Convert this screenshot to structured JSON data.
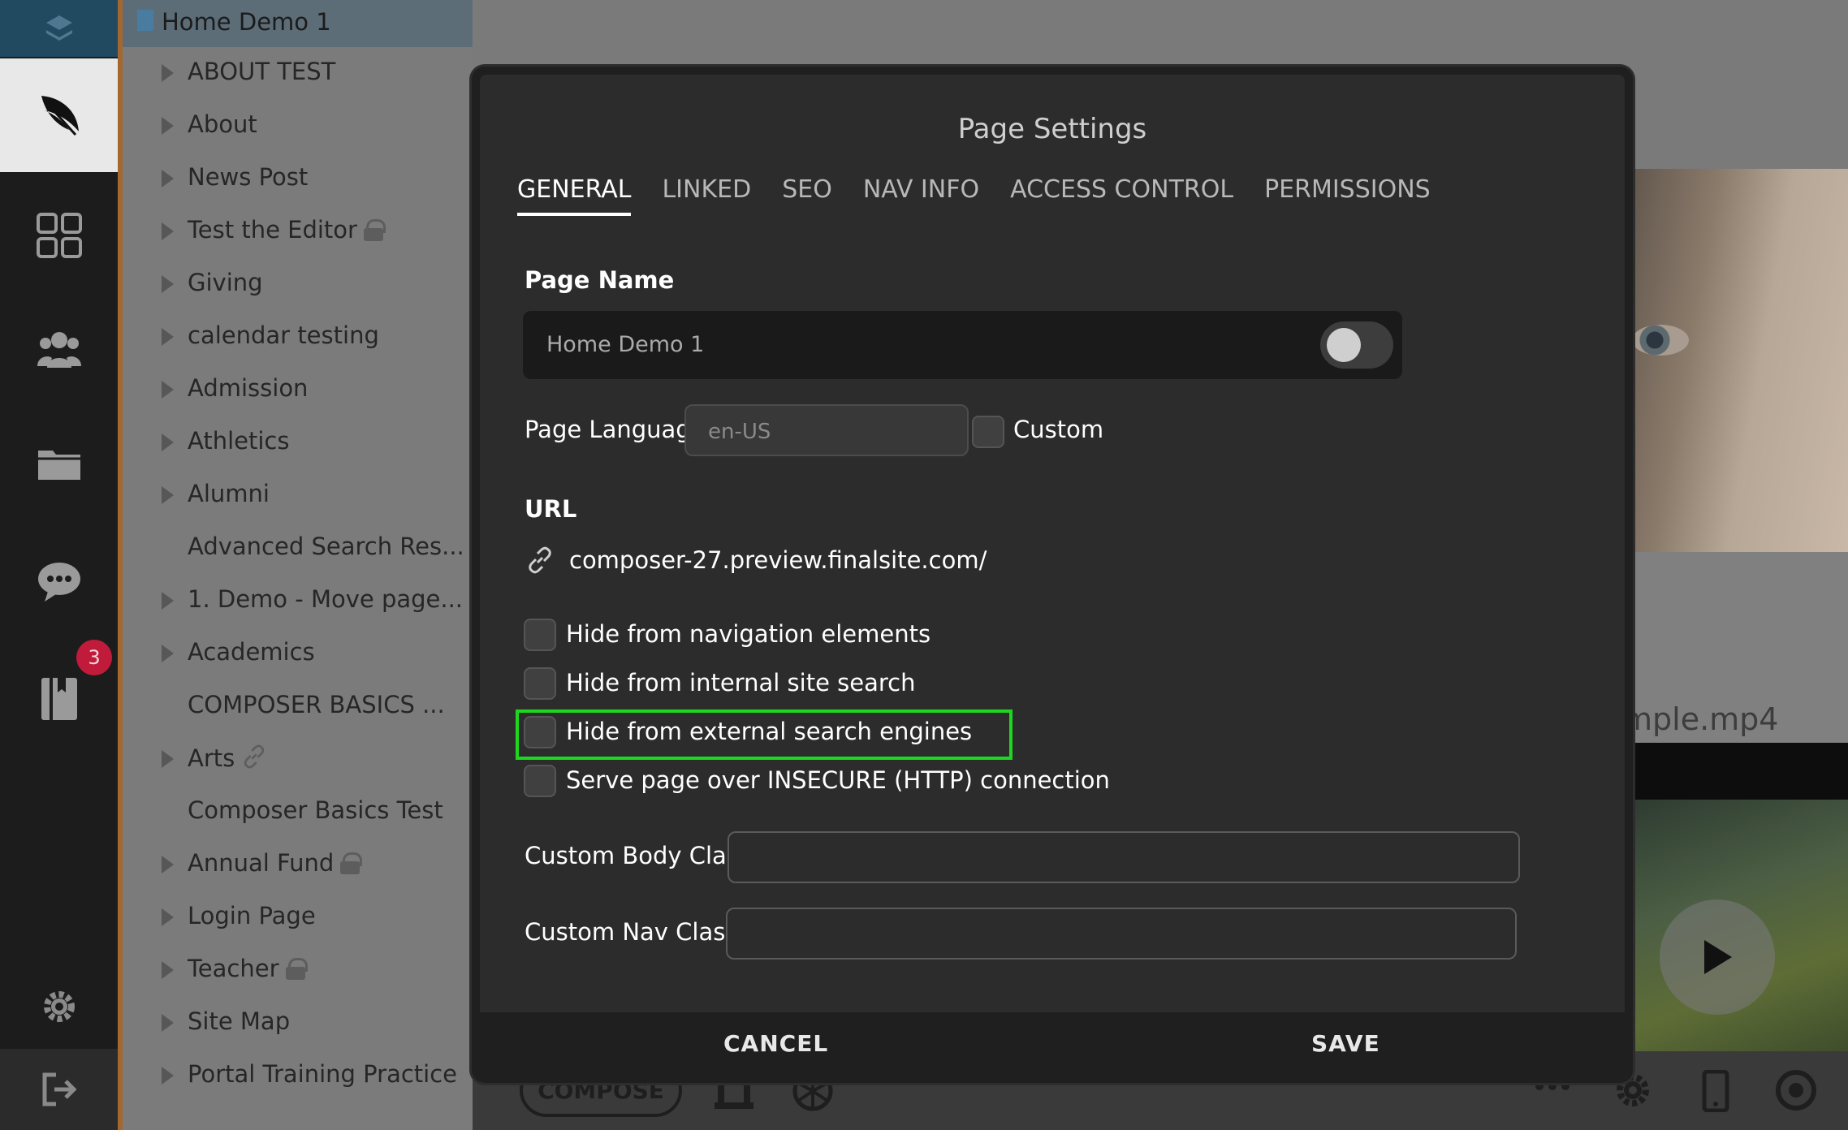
{
  "rail": {
    "badge_count": "3",
    "icons": [
      "layers-icon",
      "quill-icon",
      "apps-icon",
      "users-icon",
      "folder-icon",
      "chat-icon",
      "book-icon",
      "gear-icon",
      "logout-icon"
    ]
  },
  "tree": {
    "root_title": "Home Demo 1",
    "items": [
      {
        "label": "ABOUT TEST",
        "arrow": true,
        "lock": false,
        "link": false
      },
      {
        "label": "About",
        "arrow": true,
        "lock": false,
        "link": false
      },
      {
        "label": "News Post",
        "arrow": true,
        "lock": false,
        "link": false
      },
      {
        "label": "Test the Editor",
        "arrow": true,
        "lock": true,
        "link": false
      },
      {
        "label": "Giving",
        "arrow": true,
        "lock": false,
        "link": false
      },
      {
        "label": "calendar testing",
        "arrow": true,
        "lock": false,
        "link": false
      },
      {
        "label": "Admission",
        "arrow": true,
        "lock": false,
        "link": false
      },
      {
        "label": "Athletics",
        "arrow": true,
        "lock": false,
        "link": false
      },
      {
        "label": "Alumni",
        "arrow": true,
        "lock": false,
        "link": false
      },
      {
        "label": "Advanced Search Res...",
        "arrow": false,
        "lock": false,
        "link": false
      },
      {
        "label": "1. Demo - Move page...",
        "arrow": true,
        "lock": false,
        "link": false
      },
      {
        "label": "Academics",
        "arrow": true,
        "lock": false,
        "link": false
      },
      {
        "label": "COMPOSER BASICS ...",
        "arrow": false,
        "lock": false,
        "link": false
      },
      {
        "label": "Arts",
        "arrow": true,
        "lock": false,
        "link": true
      },
      {
        "label": "Composer Basics Test",
        "arrow": false,
        "lock": false,
        "link": false
      },
      {
        "label": "Annual Fund",
        "arrow": true,
        "lock": true,
        "link": false
      },
      {
        "label": "Login Page",
        "arrow": true,
        "lock": false,
        "link": false
      },
      {
        "label": "Teacher",
        "arrow": true,
        "lock": true,
        "link": false
      },
      {
        "label": "Site Map",
        "arrow": true,
        "lock": false,
        "link": false
      },
      {
        "label": "Portal Training Practice",
        "arrow": true,
        "lock": false,
        "link": false
      }
    ]
  },
  "preview": {
    "video_filename": "mple.mp4",
    "compose_label": "COMPOSE"
  },
  "modal": {
    "title": "Page Settings",
    "tabs": [
      "GENERAL",
      "LINKED",
      "SEO",
      "NAV INFO",
      "ACCESS CONTROL",
      "PERMISSIONS"
    ],
    "active_tab": "GENERAL",
    "page_name_label": "Page Name",
    "page_name_value": "Home Demo 1",
    "page_name_toggle_on": false,
    "page_language_label": "Page Language",
    "page_language_placeholder": "en-US",
    "custom_label": "Custom",
    "url_label": "URL",
    "url_value": "composer-27.preview.finalsite.com/",
    "options": [
      {
        "label": "Hide from navigation elements",
        "checked": false
      },
      {
        "label": "Hide from internal site search",
        "checked": false
      },
      {
        "label": "Hide from external search engines",
        "checked": false,
        "highlighted": true
      },
      {
        "label": "Serve page over INSECURE (HTTP) connection",
        "checked": false
      }
    ],
    "custom_body_class_label": "Custom Body Class",
    "custom_body_class_value": "",
    "custom_nav_class_label": "Custom Nav Class",
    "custom_nav_class_value": "",
    "cancel_label": "CANCEL",
    "save_label": "SAVE"
  },
  "colors": {
    "highlight": "#1fd61f",
    "accent_orange": "#a3672f",
    "badge_red": "#c01b3a"
  }
}
